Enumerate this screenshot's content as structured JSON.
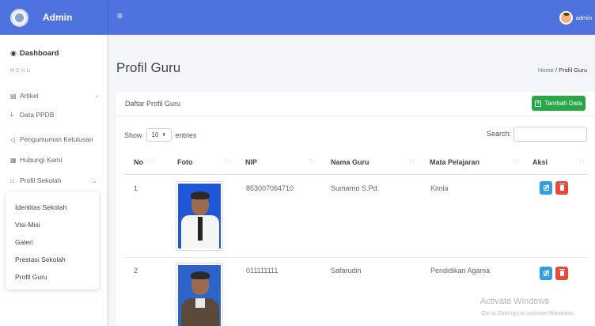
{
  "brand": {
    "title": "Admin"
  },
  "topbar": {
    "user_name": "admin"
  },
  "sidebar": {
    "dashboard": "Dashboard",
    "menu_header": "MENU",
    "items": [
      {
        "label": "Artikel",
        "icon": "newspaper-icon",
        "has_caret": true
      },
      {
        "label": "Data PPDB",
        "icon": "download-icon"
      },
      {
        "label": "Pengumuman Kelulusan",
        "icon": "megaphone-icon"
      },
      {
        "label": "Hubungi Kami",
        "icon": "contact-card-icon"
      },
      {
        "label": "Profil Sekolah",
        "icon": "school-icon",
        "has_caret": true
      }
    ],
    "submenu": [
      "Identitas Sekolah",
      "Visi-Misi",
      "Galeri",
      "Prestasi Sekolah",
      "Profil Guru"
    ]
  },
  "page": {
    "title": "Profil Guru"
  },
  "breadcrumb": {
    "home": "Home",
    "separator": "/",
    "current": "Profil Guru"
  },
  "card": {
    "title": "Daftar Profil Guru",
    "add_button": "Tambah Data",
    "show_label": "Show",
    "entries_value": "10",
    "entries_label": "entries",
    "search_label": "Search:",
    "search_value": ""
  },
  "table": {
    "columns": [
      "No",
      "Foto",
      "NIP",
      "Nama Guru",
      "Mata Pelajaran",
      "Aksi"
    ],
    "rows": [
      {
        "no": "1",
        "nip": "853007064710",
        "nama": "Sumarno S.Pd.",
        "mapel": "Kimia"
      },
      {
        "no": "2",
        "nip": "011111111",
        "nama": "Safarudin",
        "mapel": "Pendidikan Agama"
      }
    ]
  },
  "watermark": {
    "line1": "Activate Windows",
    "line2": "Go to Settings to activate Windows."
  },
  "colors": {
    "primary": "#4e73df",
    "success": "#28a745",
    "danger": "#e74a3b",
    "info": "#2e9fe6"
  }
}
